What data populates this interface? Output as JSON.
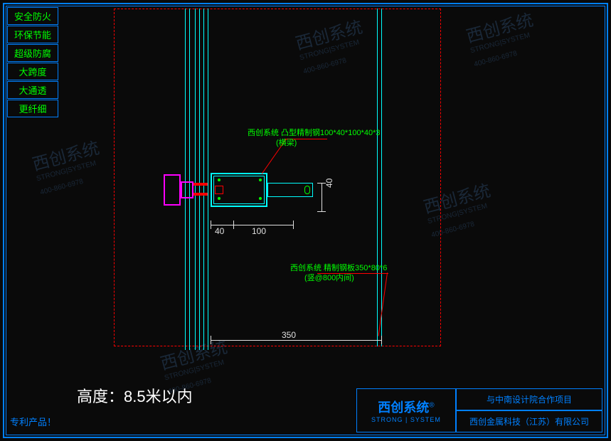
{
  "tags": [
    "安全防火",
    "环保节能",
    "超级防腐",
    "大跨度",
    "大通透",
    "更纤细"
  ],
  "patent_label": "专利产品！",
  "labels": {
    "upper_part": "西创系统 凸型精制钢100*40*100*40*3",
    "upper_part2": "(横梁)",
    "lower_part": "西创系统 精制钢板350*80*6",
    "lower_part2": "(竖@800内间)"
  },
  "dimensions": {
    "d40a": "40",
    "d40b": "40",
    "d100": "100",
    "d350": "350"
  },
  "height_text": "高度：8.5米以内",
  "title_block": {
    "brand": "西创系统",
    "brand_sub": "STRONG | SYSTEM",
    "brand_reg": "®",
    "project": "与中南设计院合作项目",
    "company": "西创金属科技（江苏）有限公司"
  },
  "watermark": {
    "main": "西创系统",
    "sub": "STRONG|SYSTEM",
    "phone": "400-860-6978"
  }
}
